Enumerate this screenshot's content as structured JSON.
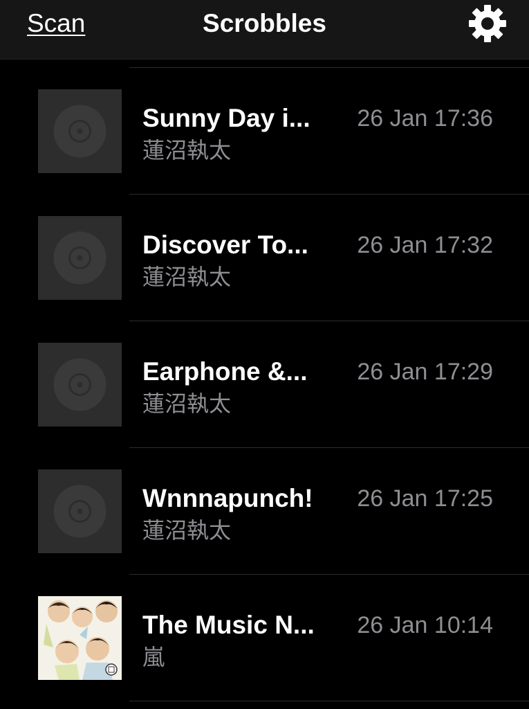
{
  "navbar": {
    "left_label": "Scan",
    "title": "Scrobbles",
    "right_icon": "gear-icon"
  },
  "colors": {
    "background": "#000000",
    "navbar": "#161616",
    "primary_text": "#ffffff",
    "secondary_text": "#8e8e93",
    "placeholder_art": "#2d2d2d"
  },
  "scrobbles": [
    {
      "title": "Sunny Day i...",
      "artist": "蓮沼執太",
      "time": "26 Jan 17:36",
      "artwork": "placeholder-disc-icon"
    },
    {
      "title": "Discover To...",
      "artist": "蓮沼執太",
      "time": "26 Jan 17:32",
      "artwork": "placeholder-disc-icon"
    },
    {
      "title": "Earphone &...",
      "artist": "蓮沼執太",
      "time": "26 Jan 17:29",
      "artwork": "placeholder-disc-icon"
    },
    {
      "title": "Wnnnapunch!",
      "artist": "蓮沼執太",
      "time": "26 Jan 17:25",
      "artwork": "placeholder-disc-icon"
    },
    {
      "title": "The Music N...",
      "artist": "嵐",
      "time": "26 Jan 10:14",
      "artwork": "album-cover-image"
    }
  ]
}
